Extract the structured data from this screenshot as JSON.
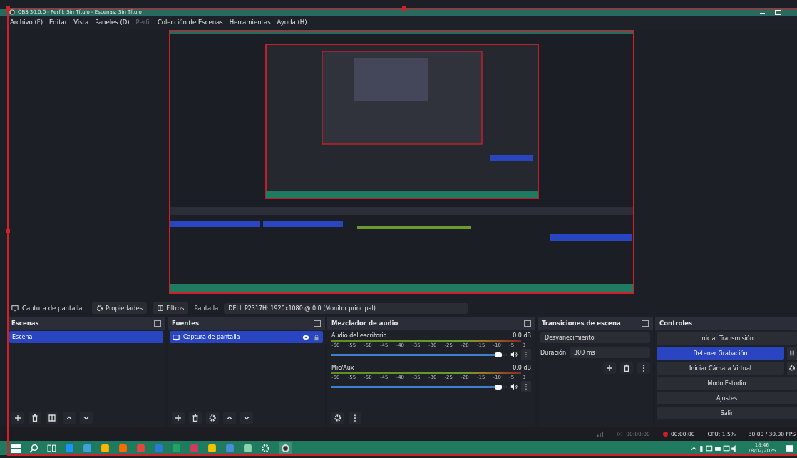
{
  "window": {
    "title": "OBS 30.0.0 - Perfil: Sin Título - Escenas: Sin Título"
  },
  "menu": [
    {
      "label": "Archivo (F)",
      "disabled": false
    },
    {
      "label": "Editar",
      "disabled": false
    },
    {
      "label": "Vista",
      "disabled": false
    },
    {
      "label": "Paneles (D)",
      "disabled": false
    },
    {
      "label": "Perfil",
      "disabled": true
    },
    {
      "label": "Colección de Escenas",
      "disabled": false
    },
    {
      "label": "Herramientas",
      "disabled": false
    },
    {
      "label": "Ayuda (H)",
      "disabled": false
    }
  ],
  "source_toolbar": {
    "source": "Captura de pantalla",
    "properties": "Propiedades",
    "filters": "Filtros",
    "display_label": "Pantalla",
    "display_value": "DELL P2317H: 1920x1080 @ 0.0 (Monitor principal)"
  },
  "scenes": {
    "title": "Escenas",
    "items": [
      {
        "label": "Escena",
        "selected": true
      }
    ]
  },
  "sources": {
    "title": "Fuentes",
    "items": [
      {
        "label": "Captura de pantalla",
        "selected": true
      }
    ]
  },
  "mixer": {
    "title": "Mezclador de audio",
    "channels": [
      {
        "name": "Audio del escritorio",
        "reading": "0.0 dB",
        "level": 0.97,
        "scale": [
          "-60",
          "-55",
          "-50",
          "-45",
          "-40",
          "-35",
          "-30",
          "-25",
          "-20",
          "-15",
          "-10",
          "-5",
          "0"
        ]
      },
      {
        "name": "Mic/Aux",
        "reading": "0.0 dB",
        "level": 0.97,
        "scale": [
          "-60",
          "-55",
          "-50",
          "-45",
          "-40",
          "-35",
          "-30",
          "-25",
          "-20",
          "-15",
          "-10",
          "-5",
          "0"
        ]
      }
    ]
  },
  "transitions": {
    "title": "Transiciones de escena",
    "transition": "Desvanecimiento",
    "duration_label": "Duración",
    "duration": "300 ms"
  },
  "controls": {
    "title": "Controles",
    "buttons": [
      {
        "label": "Iniciar Transmisión",
        "selected": false,
        "kind": "plain"
      },
      {
        "label": "Detener Grabación",
        "selected": true,
        "kind": "pause"
      },
      {
        "label": "Iniciar Cámara Virtual",
        "selected": false,
        "kind": "gear"
      },
      {
        "label": "Modo Estudio",
        "selected": false,
        "kind": "plain"
      },
      {
        "label": "Ajustes",
        "selected": false,
        "kind": "plain"
      },
      {
        "label": "Salir",
        "selected": false,
        "kind": "plain"
      }
    ]
  },
  "status": [
    {
      "text": "00:00:00",
      "kind": "stream"
    },
    {
      "text": "00:00:00",
      "kind": "record"
    },
    {
      "text": "CPU: 1.5%",
      "kind": "plain"
    },
    {
      "text": "30.00 / 30.00 FPS",
      "kind": "plain"
    }
  ],
  "taskbar": {
    "time": "18:46",
    "date": "18/02/2025"
  }
}
